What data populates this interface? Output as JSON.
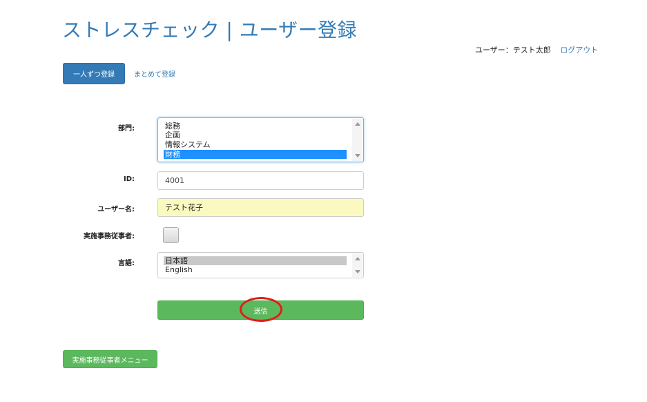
{
  "header": {
    "title": "ストレスチェック | ユーザー登録",
    "user_label": "ユーザー：テスト太郎",
    "logout_label": "ログアウト"
  },
  "tabs": {
    "single_label": "一人ずつ登録",
    "bulk_label": "まとめて登録"
  },
  "form": {
    "department": {
      "label": "部門:",
      "options": [
        "総務",
        "企画",
        "情報システム",
        "財務"
      ],
      "selected": "財務"
    },
    "id": {
      "label": "ID:",
      "value": "4001"
    },
    "username": {
      "label": "ユーザー名:",
      "value": "テスト花子"
    },
    "implementer": {
      "label": "実施事務従事者:",
      "checked": false
    },
    "language": {
      "label": "言語:",
      "options": [
        "日本語",
        "English"
      ],
      "selected": "日本語"
    },
    "submit_label": "送信"
  },
  "footer": {
    "menu_button_label": "実施事務従事者メニュー"
  },
  "colors": {
    "primary": "#337ab7",
    "success": "#5cb85c",
    "selection": "#1e90ff",
    "annotation_ring": "#e21b1b"
  }
}
